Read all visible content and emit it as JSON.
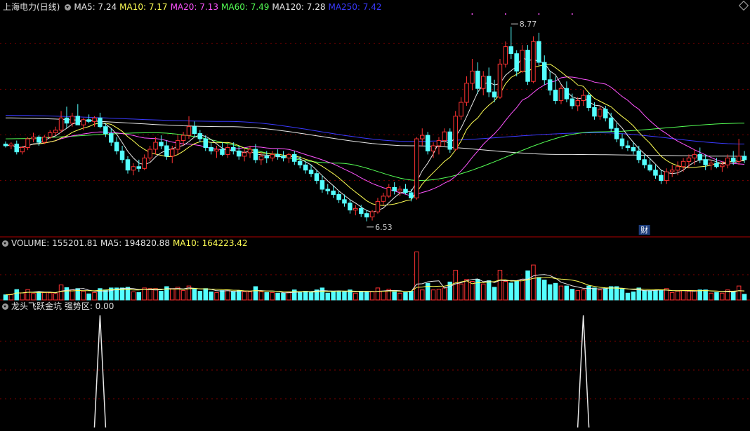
{
  "main_header": {
    "title": "上海电力(日线)",
    "ma5": "MA5: 7.24",
    "ma10": "MA10: 7.17",
    "ma20": "MA20: 7.13",
    "ma60": "MA60: 7.49",
    "ma120": "MA120: 7.28",
    "ma250": "MA250: 7.42"
  },
  "volume_header": {
    "label": "VOLUME: 155201.81",
    "ma5": "MA5: 194820.88",
    "ma10": "MA10: 164223.42"
  },
  "indicator_header": {
    "label": "龙头飞跃金坑 强势区: 0.00"
  },
  "annotations": {
    "high_label": "8.77",
    "low_label": "6.53",
    "badge": "财"
  },
  "colors": {
    "up": "#ff3232",
    "down": "#54ffff",
    "ma5": "#e8e8e8",
    "ma10": "#ffff54",
    "ma20": "#ff54ff",
    "ma60": "#54ff54",
    "ma120": "#e8e8e8",
    "ma250": "#3a3aff",
    "grid": "#800000",
    "divider": "#b00000"
  },
  "chart_data": [
    {
      "type": "candlestick",
      "title": "上海电力(日线)",
      "ylim": [
        6.4,
        8.9
      ],
      "high": 8.77,
      "low": 6.53,
      "bars": [
        [
          7.42,
          7.45,
          7.38,
          7.4
        ],
        [
          7.4,
          7.44,
          7.36,
          7.42
        ],
        [
          7.42,
          7.46,
          7.3,
          7.33
        ],
        [
          7.33,
          7.4,
          7.3,
          7.38
        ],
        [
          7.38,
          7.5,
          7.35,
          7.48
        ],
        [
          7.48,
          7.55,
          7.44,
          7.5
        ],
        [
          7.5,
          7.52,
          7.4,
          7.44
        ],
        [
          7.44,
          7.52,
          7.42,
          7.5
        ],
        [
          7.5,
          7.58,
          7.48,
          7.55
        ],
        [
          7.55,
          7.62,
          7.52,
          7.58
        ],
        [
          7.58,
          7.8,
          7.55,
          7.72
        ],
        [
          7.72,
          7.85,
          7.6,
          7.66
        ],
        [
          7.66,
          7.78,
          7.62,
          7.74
        ],
        [
          7.74,
          7.88,
          7.7,
          7.64
        ],
        [
          7.64,
          7.72,
          7.58,
          7.7
        ],
        [
          7.7,
          7.76,
          7.66,
          7.68
        ],
        [
          7.68,
          7.74,
          7.62,
          7.72
        ],
        [
          7.72,
          7.78,
          7.6,
          7.62
        ],
        [
          7.62,
          7.66,
          7.5,
          7.54
        ],
        [
          7.54,
          7.6,
          7.4,
          7.44
        ],
        [
          7.44,
          7.5,
          7.3,
          7.34
        ],
        [
          7.34,
          7.4,
          7.2,
          7.24
        ],
        [
          7.24,
          7.28,
          7.08,
          7.12
        ],
        [
          7.12,
          7.2,
          7.06,
          7.16
        ],
        [
          7.16,
          7.24,
          7.1,
          7.14
        ],
        [
          7.14,
          7.3,
          7.12,
          7.26
        ],
        [
          7.26,
          7.4,
          7.22,
          7.36
        ],
        [
          7.36,
          7.5,
          7.3,
          7.44
        ],
        [
          7.44,
          7.52,
          7.36,
          7.4
        ],
        [
          7.4,
          7.46,
          7.24,
          7.28
        ],
        [
          7.28,
          7.4,
          7.2,
          7.36
        ],
        [
          7.36,
          7.52,
          7.3,
          7.46
        ],
        [
          7.46,
          7.56,
          7.4,
          7.52
        ],
        [
          7.52,
          7.74,
          7.48,
          7.62
        ],
        [
          7.62,
          7.68,
          7.5,
          7.54
        ],
        [
          7.54,
          7.58,
          7.44,
          7.48
        ],
        [
          7.48,
          7.52,
          7.34,
          7.38
        ],
        [
          7.38,
          7.44,
          7.3,
          7.34
        ],
        [
          7.34,
          7.4,
          7.26,
          7.36
        ],
        [
          7.36,
          7.44,
          7.28,
          7.3
        ],
        [
          7.3,
          7.42,
          7.26,
          7.38
        ],
        [
          7.38,
          7.44,
          7.3,
          7.34
        ],
        [
          7.34,
          7.4,
          7.24,
          7.28
        ],
        [
          7.28,
          7.36,
          7.22,
          7.32
        ],
        [
          7.32,
          7.4,
          7.26,
          7.36
        ],
        [
          7.36,
          7.42,
          7.2,
          7.24
        ],
        [
          7.24,
          7.32,
          7.18,
          7.28
        ],
        [
          7.28,
          7.34,
          7.2,
          7.26
        ],
        [
          7.26,
          7.34,
          7.22,
          7.3
        ],
        [
          7.3,
          7.36,
          7.24,
          7.28
        ],
        [
          7.28,
          7.34,
          7.22,
          7.26
        ],
        [
          7.26,
          7.32,
          7.2,
          7.3
        ],
        [
          7.3,
          7.34,
          7.18,
          7.22
        ],
        [
          7.22,
          7.28,
          7.14,
          7.18
        ],
        [
          7.18,
          7.22,
          7.08,
          7.12
        ],
        [
          7.12,
          7.18,
          7.04,
          7.08
        ],
        [
          7.08,
          7.12,
          6.96,
          7.0
        ],
        [
          7.0,
          7.06,
          6.86,
          6.9
        ],
        [
          6.9,
          6.96,
          6.84,
          6.88
        ],
        [
          6.88,
          6.94,
          6.8,
          6.84
        ],
        [
          6.84,
          6.88,
          6.74,
          6.78
        ],
        [
          6.78,
          6.84,
          6.7,
          6.74
        ],
        [
          6.74,
          6.78,
          6.62,
          6.66
        ],
        [
          6.66,
          6.72,
          6.6,
          6.68
        ],
        [
          6.68,
          6.72,
          6.58,
          6.62
        ],
        [
          6.62,
          6.66,
          6.53,
          6.58
        ],
        [
          6.58,
          6.66,
          6.54,
          6.64
        ],
        [
          6.64,
          6.8,
          6.62,
          6.76
        ],
        [
          6.76,
          6.86,
          6.72,
          6.82
        ],
        [
          6.82,
          6.96,
          6.8,
          6.92
        ],
        [
          6.92,
          6.98,
          6.84,
          6.88
        ],
        [
          6.88,
          6.94,
          6.82,
          6.9
        ],
        [
          6.9,
          6.96,
          6.84,
          6.86
        ],
        [
          6.86,
          6.9,
          6.76,
          6.8
        ],
        [
          6.8,
          7.5,
          6.78,
          7.48
        ],
        [
          7.48,
          7.6,
          7.4,
          7.52
        ],
        [
          7.52,
          7.56,
          7.3,
          7.34
        ],
        [
          7.34,
          7.44,
          7.26,
          7.4
        ],
        [
          7.4,
          7.5,
          7.3,
          7.46
        ],
        [
          7.46,
          7.6,
          7.4,
          7.56
        ],
        [
          7.56,
          7.6,
          7.32,
          7.36
        ],
        [
          7.36,
          7.8,
          7.34,
          7.74
        ],
        [
          7.74,
          7.96,
          7.7,
          7.9
        ],
        [
          7.9,
          8.2,
          7.86,
          8.12
        ],
        [
          8.12,
          8.4,
          8.04,
          8.26
        ],
        [
          8.26,
          8.36,
          8.0,
          8.06
        ],
        [
          8.06,
          8.26,
          7.98,
          8.2
        ],
        [
          8.2,
          8.3,
          7.96,
          8.02
        ],
        [
          8.02,
          8.16,
          7.9,
          7.96
        ],
        [
          7.96,
          8.4,
          7.94,
          8.34
        ],
        [
          8.34,
          8.6,
          8.3,
          8.54
        ],
        [
          8.54,
          8.77,
          8.4,
          8.46
        ],
        [
          8.46,
          8.5,
          8.2,
          8.26
        ],
        [
          8.26,
          8.56,
          8.24,
          8.5
        ],
        [
          8.5,
          8.56,
          8.1,
          8.14
        ],
        [
          8.14,
          8.66,
          8.12,
          8.6
        ],
        [
          8.6,
          8.7,
          8.32,
          8.36
        ],
        [
          8.36,
          8.44,
          8.1,
          8.16
        ],
        [
          8.16,
          8.26,
          7.98,
          8.04
        ],
        [
          8.04,
          8.2,
          7.88,
          7.92
        ],
        [
          7.92,
          8.1,
          7.88,
          8.06
        ],
        [
          8.06,
          8.14,
          7.9,
          7.94
        ],
        [
          7.94,
          8.0,
          7.82,
          7.86
        ],
        [
          7.86,
          7.96,
          7.8,
          7.92
        ],
        [
          7.92,
          8.04,
          7.86,
          7.98
        ],
        [
          7.98,
          8.02,
          7.8,
          7.84
        ],
        [
          7.84,
          7.9,
          7.7,
          7.74
        ],
        [
          7.74,
          7.86,
          7.7,
          7.82
        ],
        [
          7.82,
          7.86,
          7.68,
          7.72
        ],
        [
          7.72,
          7.78,
          7.56,
          7.6
        ],
        [
          7.6,
          7.66,
          7.44,
          7.48
        ],
        [
          7.48,
          7.54,
          7.36,
          7.4
        ],
        [
          7.4,
          7.46,
          7.34,
          7.38
        ],
        [
          7.38,
          7.44,
          7.3,
          7.34
        ],
        [
          7.34,
          7.4,
          7.2,
          7.24
        ],
        [
          7.24,
          7.3,
          7.14,
          7.18
        ],
        [
          7.18,
          7.26,
          7.1,
          7.12
        ],
        [
          7.12,
          7.18,
          7.02,
          7.06
        ],
        [
          7.06,
          7.12,
          6.96,
          7.0
        ],
        [
          7.0,
          7.14,
          6.96,
          7.1
        ],
        [
          7.1,
          7.18,
          7.04,
          7.12
        ],
        [
          7.12,
          7.22,
          7.06,
          7.16
        ],
        [
          7.16,
          7.26,
          7.1,
          7.22
        ],
        [
          7.22,
          7.3,
          7.14,
          7.26
        ],
        [
          7.26,
          7.36,
          7.18,
          7.3
        ],
        [
          7.3,
          7.38,
          7.2,
          7.24
        ],
        [
          7.24,
          7.3,
          7.12,
          7.18
        ],
        [
          7.18,
          7.24,
          7.12,
          7.2
        ],
        [
          7.2,
          7.26,
          7.14,
          7.16
        ],
        [
          7.16,
          7.22,
          7.1,
          7.18
        ],
        [
          7.18,
          7.3,
          7.14,
          7.26
        ],
        [
          7.26,
          7.34,
          7.18,
          7.22
        ],
        [
          7.22,
          7.48,
          7.18,
          7.28
        ],
        [
          7.28,
          7.34,
          7.2,
          7.24
        ]
      ]
    },
    {
      "type": "bar",
      "title": "VOLUME",
      "values": [
        155201.81
      ],
      "ma5": 194820.88,
      "ma10": 164223.42
    },
    {
      "type": "line",
      "title": "龙头飞跃金坑 强势区",
      "value": 0.0,
      "ylim": [
        0,
        1
      ],
      "spikes_at_bar": [
        17,
        104
      ]
    }
  ]
}
